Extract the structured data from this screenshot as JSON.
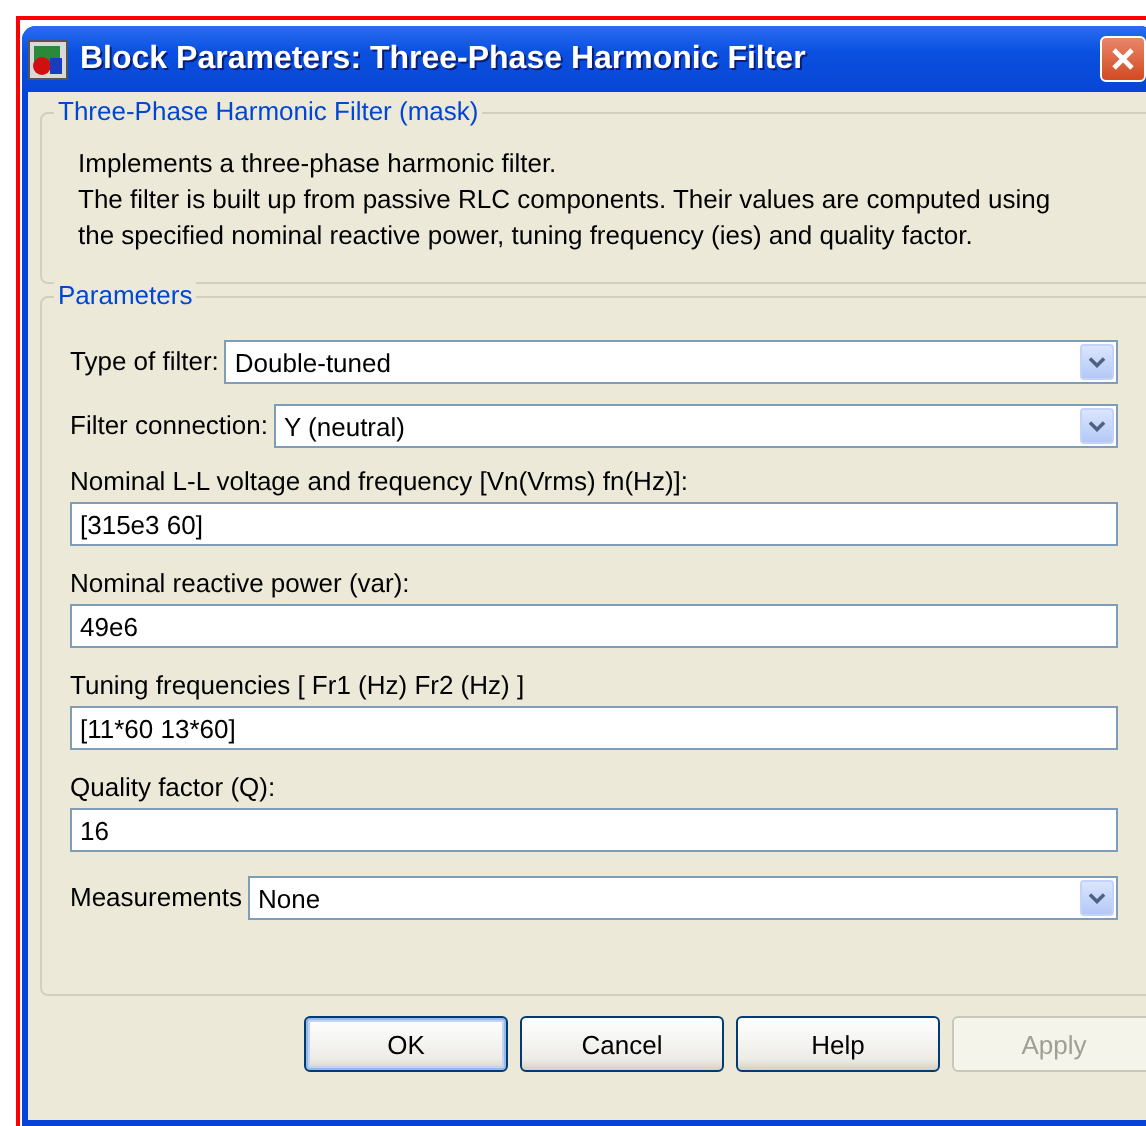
{
  "window": {
    "title": "Block Parameters: Three-Phase Harmonic Filter"
  },
  "description": {
    "title": "Three-Phase Harmonic Filter (mask)",
    "lines": [
      "Implements a three-phase harmonic filter.",
      "The filter is built up from passive RLC components. Their values are computed using",
      "the specified  nominal reactive power, tuning frequency (ies) and quality factor."
    ]
  },
  "parameters": {
    "title": "Parameters",
    "fields": [
      {
        "kind": "dropdown",
        "label": "Type of filter:",
        "value": "Double-tuned"
      },
      {
        "kind": "dropdown",
        "label": "Filter connection:",
        "value": "Y (neutral)"
      },
      {
        "kind": "text",
        "label": "Nominal L-L voltage and frequency  [Vn(Vrms) fn(Hz)]:",
        "value": "[315e3 60]"
      },
      {
        "kind": "text",
        "label": "Nominal reactive power (var):",
        "value": "49e6"
      },
      {
        "kind": "text",
        "label": "Tuning frequencies [ Fr1 (Hz)   Fr2 (Hz) ]",
        "value": "[11*60 13*60]"
      },
      {
        "kind": "text",
        "label": "Quality factor (Q):",
        "value": "16"
      },
      {
        "kind": "dropdown",
        "label": "Measurements",
        "value": "None"
      }
    ]
  },
  "buttons": [
    {
      "label": "OK",
      "default": true,
      "disabled": false
    },
    {
      "label": "Cancel",
      "default": false,
      "disabled": false
    },
    {
      "label": "Help",
      "default": false,
      "disabled": false
    },
    {
      "label": "Apply",
      "default": false,
      "disabled": true
    }
  ]
}
